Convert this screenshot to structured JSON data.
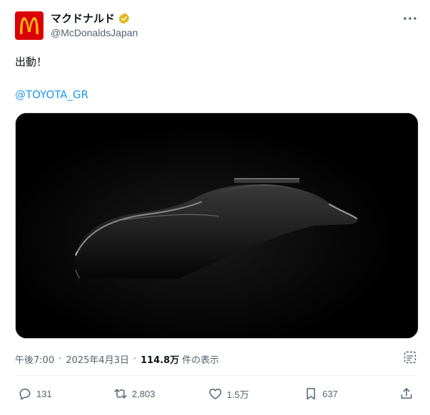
{
  "author": {
    "display_name": "マクドナルド",
    "handle": "@McDonaldsJapan",
    "avatar_icon": "mcdonalds-arches-logo",
    "verified_icon": "gold-verified-badge",
    "verified_color": "#e2b719",
    "brand_color": "#db0007"
  },
  "post": {
    "text": "出動！",
    "mention": "@TOYOTA_GR",
    "media_description_icon": "car-silhouette-image"
  },
  "meta": {
    "time": "午後7:00",
    "separator": "·",
    "date": "2025年4月3日",
    "views_count": "114.8万",
    "views_label": "件の表示"
  },
  "actions": {
    "reply_count": "131",
    "retweet_count": "2,803",
    "like_count": "1.5万",
    "bookmark_count": "637"
  },
  "colors": {
    "link": "#1d9bf0",
    "secondary_text": "#536471",
    "primary_text": "#0f1419"
  }
}
